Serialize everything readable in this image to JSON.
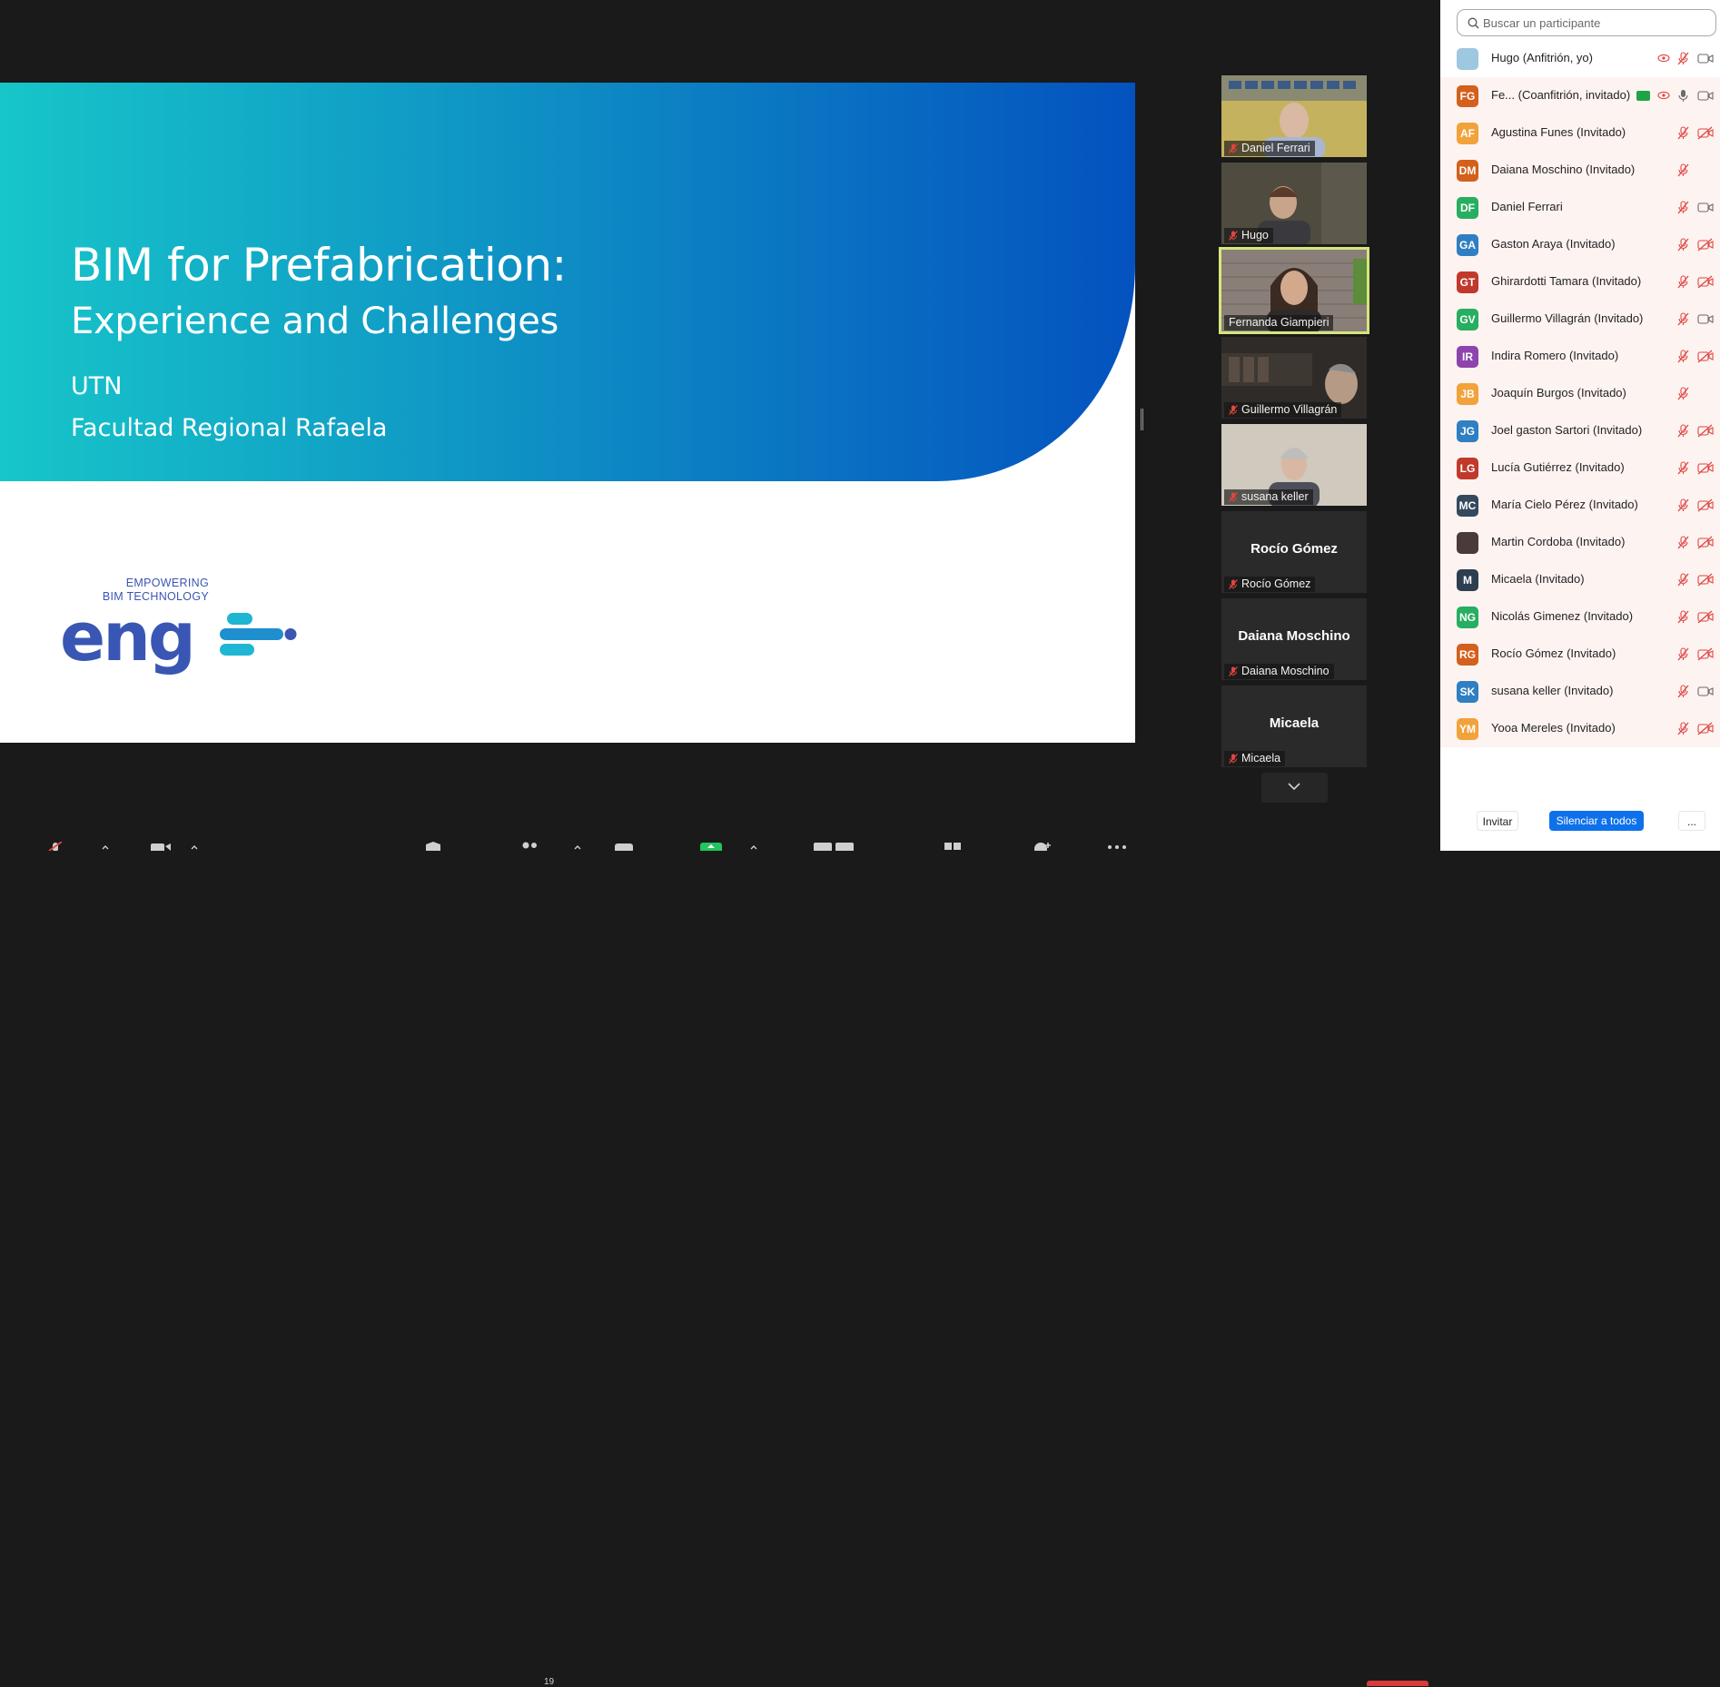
{
  "slide": {
    "title": "BIM for Prefabrication:",
    "subtitle": "Experience and Challenges",
    "organization": "UTN",
    "faculty": "Facultad Regional Rafaela",
    "logo_word": "eng",
    "logo_tagline_1": "EMPOWERING",
    "logo_tagline_2": "BIM TECHNOLOGY"
  },
  "video_tiles": [
    {
      "name": "Daniel Ferrari",
      "has_video": true,
      "muted": true
    },
    {
      "name": "Hugo",
      "has_video": true,
      "muted": true
    },
    {
      "name": "Fernanda Giampieri",
      "has_video": true,
      "muted": false,
      "active_speaker": true
    },
    {
      "name": "Guillermo Villagrán",
      "has_video": true,
      "muted": true
    },
    {
      "name": "susana keller",
      "has_video": true,
      "muted": true
    },
    {
      "name": "Rocío Gómez",
      "display": "Rocío Gómez",
      "has_video": false,
      "muted": true
    },
    {
      "name": "Daiana Moschino",
      "display": "Daiana Moschino",
      "has_video": false,
      "muted": true
    },
    {
      "name": "Micaela",
      "display": "Micaela",
      "has_video": false,
      "muted": true
    }
  ],
  "toolbar": {
    "participant_count": "19"
  },
  "participants_panel": {
    "search_placeholder": "Buscar un participante",
    "participants": [
      {
        "initials": "",
        "name": "Hugo (Anfitrión, yo)",
        "color": "#9ec7e0",
        "mic": "muted",
        "video": "on"
      },
      {
        "initials": "FG",
        "name": "Fe...  (Coanfitrión, invitado)",
        "color": "#d3601c",
        "mic": "on",
        "video": "on",
        "cohost_badge": true
      },
      {
        "initials": "AF",
        "name": "Agustina Funes (Invitado)",
        "color": "#f2a23a",
        "mic": "muted",
        "video": "off"
      },
      {
        "initials": "DM",
        "name": "Daiana Moschino (Invitado)",
        "color": "#d3601c",
        "mic": "muted",
        "video": "none"
      },
      {
        "initials": "DF",
        "name": "Daniel Ferrari",
        "color": "#27ae60",
        "mic": "muted",
        "video": "on"
      },
      {
        "initials": "GA",
        "name": "Gaston Araya (Invitado)",
        "color": "#2f7fc2",
        "mic": "muted",
        "video": "off"
      },
      {
        "initials": "GT",
        "name": "Ghirardotti Tamara (Invitado)",
        "color": "#c0392b",
        "mic": "muted",
        "video": "off"
      },
      {
        "initials": "GV",
        "name": "Guillermo Villagrán (Invitado)",
        "color": "#27ae60",
        "mic": "muted",
        "video": "on"
      },
      {
        "initials": "IR",
        "name": "Indira Romero (Invitado)",
        "color": "#8e44ad",
        "mic": "muted",
        "video": "off"
      },
      {
        "initials": "JB",
        "name": "Joaquín Burgos (Invitado)",
        "color": "#f2a23a",
        "mic": "muted",
        "video": "none"
      },
      {
        "initials": "JG",
        "name": "Joel gaston Sartori (Invitado)",
        "color": "#2f7fc2",
        "mic": "muted",
        "video": "off"
      },
      {
        "initials": "LG",
        "name": "Lucía Gutiérrez (Invitado)",
        "color": "#c0392b",
        "mic": "muted",
        "video": "off"
      },
      {
        "initials": "MC",
        "name": "María Cielo Pérez (Invitado)",
        "color": "#34495e",
        "mic": "muted",
        "video": "off"
      },
      {
        "initials": "",
        "name": "Martin Cordoba (Invitado)",
        "color": "#4a3a3a",
        "mic": "muted",
        "video": "off"
      },
      {
        "initials": "M",
        "name": "Micaela (Invitado)",
        "color": "#2c3e50",
        "mic": "muted",
        "video": "off"
      },
      {
        "initials": "NG",
        "name": "Nicolás Gimenez (Invitado)",
        "color": "#27ae60",
        "mic": "muted",
        "video": "off"
      },
      {
        "initials": "RG",
        "name": "Rocío Gómez (Invitado)",
        "color": "#d3601c",
        "mic": "muted",
        "video": "off"
      },
      {
        "initials": "SK",
        "name": "susana keller (Invitado)",
        "color": "#2f7fc2",
        "mic": "muted",
        "video": "on"
      },
      {
        "initials": "YM",
        "name": "Yooa Mereles (Invitado)",
        "color": "#f2a23a",
        "mic": "muted",
        "video": "off"
      }
    ],
    "footer": {
      "invite": "Invitar",
      "mute_all": "Silenciar a todos",
      "more": "..."
    }
  },
  "colors": {
    "accent_blue": "#0e71eb",
    "slide_band_start": "#17c6c9",
    "slide_band_end": "#0452bf",
    "active_speaker_border": "#d6e67c",
    "mute_red": "#e0453f"
  },
  "icons": {
    "search": "search-icon",
    "mic_muted": "mic-muted-icon",
    "mic_on": "mic-icon",
    "video_on": "video-icon",
    "video_off": "video-off-icon",
    "screen_share_indicator": "eye-icon",
    "strip_scroll": "chevron-down-icon"
  }
}
